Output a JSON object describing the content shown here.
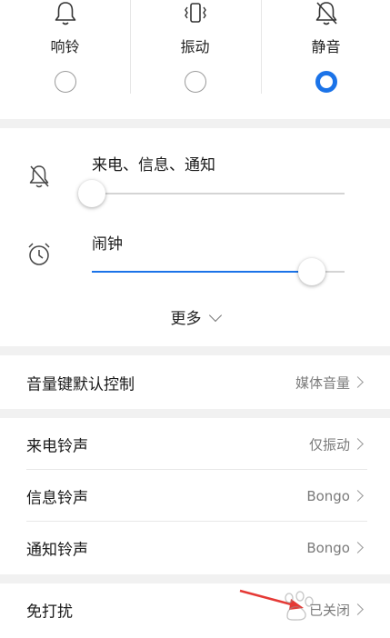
{
  "modes": {
    "items": [
      {
        "label": "响铃",
        "icon": "bell-icon",
        "selected": false
      },
      {
        "label": "振动",
        "icon": "vibrate-icon",
        "selected": false
      },
      {
        "label": "静音",
        "icon": "bell-off-icon",
        "selected": true
      }
    ]
  },
  "volumes": {
    "ringer": {
      "label": "来电、信息、通知",
      "icon": "bell-off-icon",
      "level": 0.0
    },
    "alarm": {
      "label": "闹钟",
      "icon": "alarm-clock-icon",
      "level": 0.87
    },
    "more_label": "更多"
  },
  "volume_key": {
    "title": "音量键默认控制",
    "value": "媒体音量"
  },
  "ringtones": [
    {
      "title": "来电铃声",
      "value": "仅振动"
    },
    {
      "title": "信息铃声",
      "value": "Bongo"
    },
    {
      "title": "通知铃声",
      "value": "Bongo"
    }
  ],
  "dnd": {
    "title": "免打扰",
    "value": "已关闭"
  },
  "colors": {
    "accent": "#1b73e8",
    "annotation_arrow": "#e53935"
  }
}
